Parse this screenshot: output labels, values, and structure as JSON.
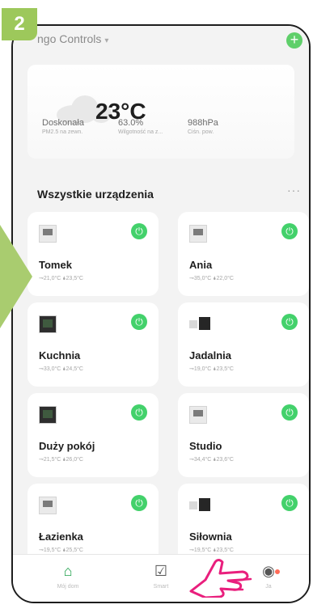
{
  "step_badge": "2",
  "header": {
    "home_name": "ngo Controls",
    "caret": "▾",
    "add_symbol": "+"
  },
  "weather": {
    "temperature": "23°C",
    "stats": [
      {
        "value": "Doskonała",
        "label": "PM2.5 na zewn."
      },
      {
        "value": "63.0%",
        "label": "Wilgotność na z..."
      },
      {
        "value": "988hPa",
        "label": "Ciśn. pow."
      }
    ]
  },
  "section": {
    "title": "Wszystkie urządzenia",
    "more": "···"
  },
  "devices": [
    {
      "name": "Tomek",
      "meta": "⊸21,0°C  🌢23,5°C",
      "type": "light"
    },
    {
      "name": "Ania",
      "meta": "⊸35,0°C  🌢22,0°C",
      "type": "light"
    },
    {
      "name": "Kuchnia",
      "meta": "⊸33,0°C  🌢24,5°C",
      "type": "dark"
    },
    {
      "name": "Jadalnia",
      "meta": "⊸19,0°C  🌢23,5°C",
      "type": "pair"
    },
    {
      "name": "Duży pokój",
      "meta": "⊸21,5°C  🌢26,0°C",
      "type": "dark"
    },
    {
      "name": "Studio",
      "meta": "⊸34,4°C  🌢23,6°C",
      "type": "light"
    },
    {
      "name": "Łazienka",
      "meta": "⊸19,5°C  🌢25,5°C",
      "type": "light"
    },
    {
      "name": "Siłownia",
      "meta": "⊸19,5°C  🌢23,5°C",
      "type": "pair"
    }
  ],
  "power_symbol": "⏻",
  "nav": [
    {
      "label": "Mój dom",
      "icon": "home-icon"
    },
    {
      "label": "Smart",
      "icon": "checklist-icon"
    },
    {
      "label": "Ja",
      "icon": "profile-icon"
    }
  ],
  "accent_colors": {
    "badge": "#9dc85b",
    "power": "#43d16b",
    "highlight_hand": "#e91f7d"
  }
}
